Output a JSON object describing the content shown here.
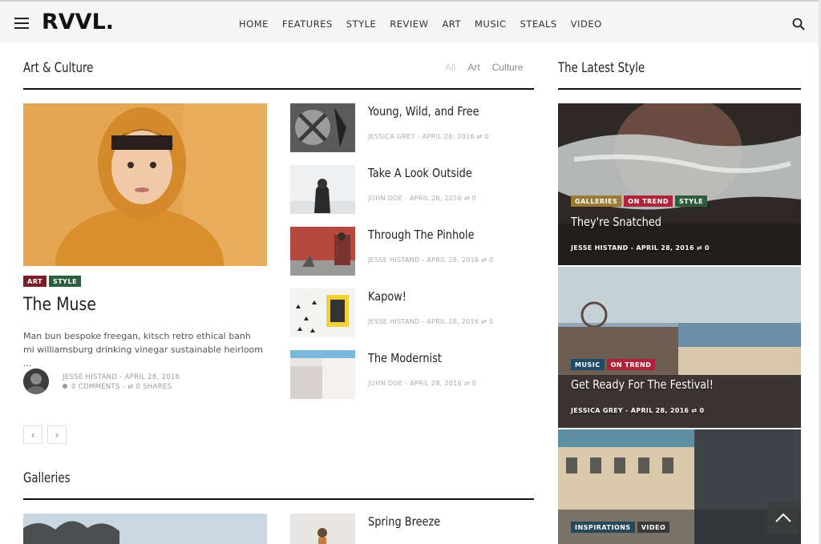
{
  "header": {
    "logo": "RVVL.",
    "nav": [
      "HOME",
      "FEATURES",
      "STYLE",
      "REVIEW",
      "ART",
      "MUSIC",
      "STEALS",
      "VIDEO"
    ]
  },
  "art_culture": {
    "title": "Art & Culture",
    "filters": [
      "All",
      "Art",
      "Culture"
    ],
    "featured": {
      "badges": [
        "ART",
        "STYLE"
      ],
      "title": "The Muse",
      "excerpt": "Man bun bespoke freegan, kitsch retro ethical banh mi williamsburg drinking vinegar sustainable heirloom ...",
      "author_line": "JESSE HISTAND - APRIL 28, 2016",
      "stats_line": "0 COMMENTS - ⇄ 0 SHARES"
    },
    "list": [
      {
        "title": "Young, Wild, and Free",
        "meta": "JESSICA GREY - APRIL 28, 2016 ⇄ 0"
      },
      {
        "title": "Take A Look Outside",
        "meta": "JOHN DOE - APRIL 28, 2016 ⇄ 0"
      },
      {
        "title": "Through The Pinhole",
        "meta": "JESSE HISTAND - APRIL 28, 2016 ⇄ 0"
      },
      {
        "title": "Kapow!",
        "meta": "JESSE HISTAND - APRIL 28, 2016 ⇄ 0"
      },
      {
        "title": "The Modernist",
        "meta": "JOHN DOE - APRIL 28, 2016 ⇄ 0"
      }
    ],
    "pager": [
      "‹",
      "›"
    ]
  },
  "galleries": {
    "title": "Galleries",
    "list": [
      {
        "title": "Spring Breeze"
      }
    ]
  },
  "latest_style": {
    "title": "The Latest Style",
    "cards": [
      {
        "badges": [
          "GALLERIES",
          "ON TREND",
          "STYLE"
        ],
        "title": "They're Snatched",
        "meta": "JESSE HISTAND - APRIL 28, 2016 ⇄ 0"
      },
      {
        "badges": [
          "MUSIC",
          "ON TREND"
        ],
        "title": "Get Ready For The Festival!",
        "meta": "JESSICA GREY - APRIL 28, 2016 ⇄ 0"
      },
      {
        "badges": [
          "INSPIRATIONS",
          "VIDEO"
        ],
        "title": "",
        "meta": ""
      }
    ]
  },
  "colors": {
    "art": "#7b1e2a",
    "style": "#2c5e3e",
    "galleries": "#9d7a33",
    "on_trend": "#b0223a",
    "music": "#1f4d68",
    "inspirations": "#27485a",
    "video": "#3a3a3a"
  }
}
